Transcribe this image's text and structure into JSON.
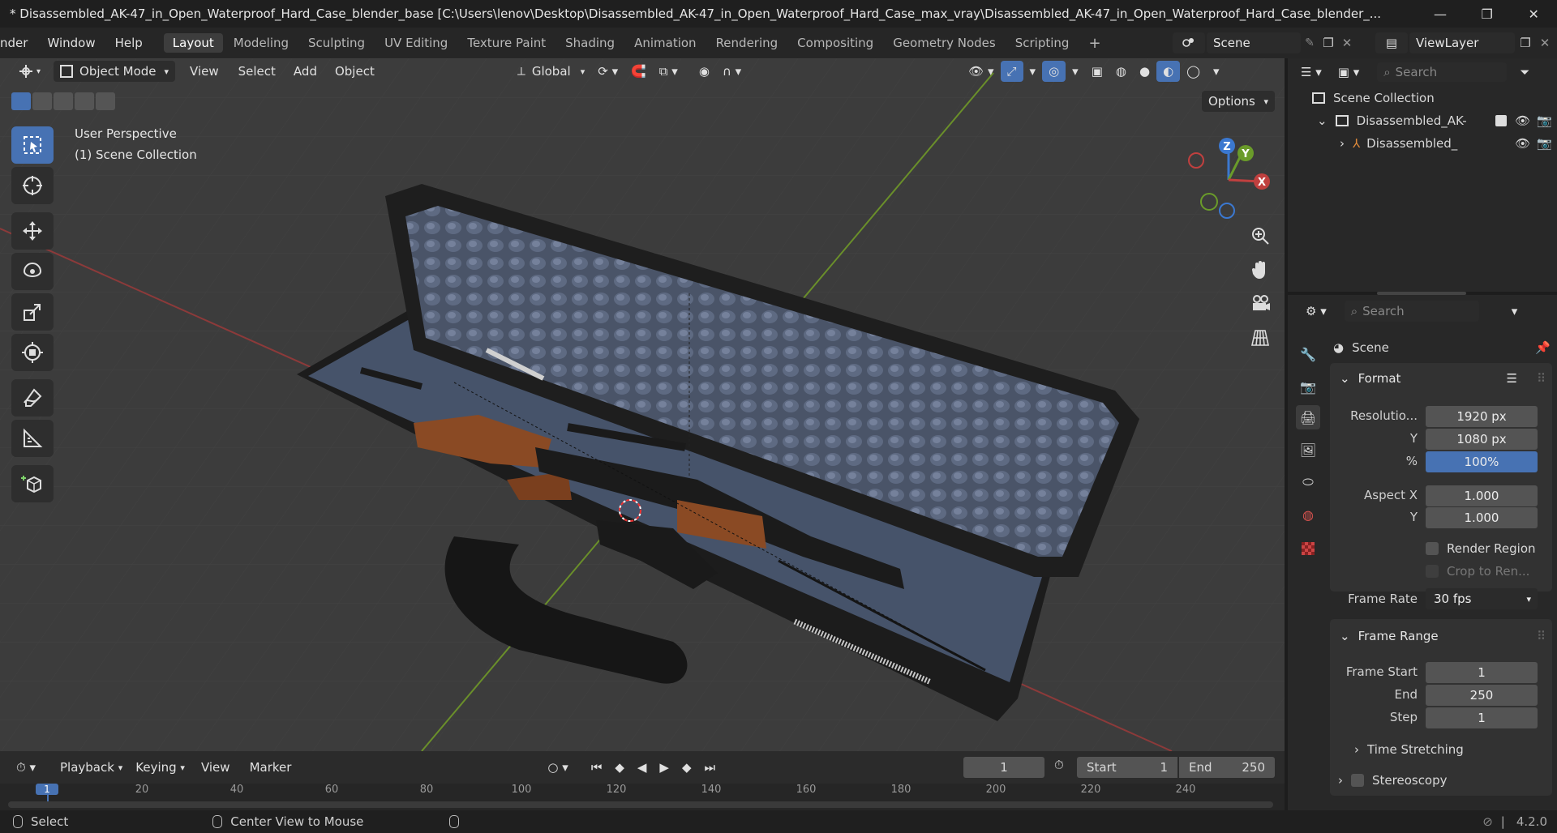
{
  "window": {
    "title": "* Disassembled_AK-47_in_Open_Waterproof_Hard_Case_blender_base [C:\\Users\\lenov\\Desktop\\Disassembled_AK-47_in_Open_Waterproof_Hard_Case_max_vray\\Disassembled_AK-47_in_Open_Waterproof_Hard_Case_blender_...",
    "minimize": "—",
    "maximize": "❐",
    "close": "✕"
  },
  "menu": {
    "items": [
      "nder",
      "Window",
      "Help"
    ],
    "workspaces": [
      "Layout",
      "Modeling",
      "Sculpting",
      "UV Editing",
      "Texture Paint",
      "Shading",
      "Animation",
      "Rendering",
      "Compositing",
      "Geometry Nodes",
      "Scripting"
    ],
    "active_workspace": "Layout",
    "add_tab": "+",
    "scene_name": "Scene",
    "view_layer": "ViewLayer"
  },
  "viewport": {
    "mode": "Object Mode",
    "menus": [
      "View",
      "Select",
      "Add",
      "Object"
    ],
    "transform_orientation": "Global",
    "options_label": "Options",
    "perspective_label": "User Perspective",
    "collection_label": "(1) Scene Collection",
    "gizmo": {
      "z": "Z",
      "y": "Y",
      "x": "X"
    }
  },
  "timeline": {
    "menus": [
      "Playback",
      "Keying",
      "View",
      "Marker"
    ],
    "current_frame": "1",
    "start_label": "Start",
    "start_value": "1",
    "end_label": "End",
    "end_value": "250",
    "ruler": [
      "1",
      "20",
      "40",
      "60",
      "80",
      "100",
      "120",
      "140",
      "160",
      "180",
      "200",
      "220",
      "240"
    ]
  },
  "status": {
    "select": "Select",
    "center_view": "Center View to Mouse",
    "version": "4.2.0"
  },
  "outliner": {
    "search_placeholder": "Search",
    "root": "Scene Collection",
    "collection": "Disassembled_AK-",
    "object": "Disassembled_"
  },
  "properties": {
    "search_placeholder": "Search",
    "context": "Scene",
    "format_title": "Format",
    "resolution_x_label": "Resolutio...",
    "resolution_x": "1920 px",
    "resolution_y_label": "Y",
    "resolution_y": "1080 px",
    "percent_label": "%",
    "percent": "100%",
    "aspect_x_label": "Aspect X",
    "aspect_x": "1.000",
    "aspect_y_label": "Y",
    "aspect_y": "1.000",
    "render_region": "Render Region",
    "crop": "Crop to Ren...",
    "frame_rate_label": "Frame Rate",
    "frame_rate": "30 fps",
    "frame_range_title": "Frame Range",
    "frame_start_label": "Frame Start",
    "frame_start": "1",
    "end_label": "End",
    "end": "250",
    "step_label": "Step",
    "step": "1",
    "time_stretching": "Time Stretching",
    "stereoscopy": "Stereoscopy"
  },
  "colors": {
    "accent": "#4772b3",
    "viewport_bg": "#3c3c3c",
    "axis_x": "#c0403f",
    "axis_y": "#6a9b2a",
    "axis_z": "#3b78d0"
  }
}
